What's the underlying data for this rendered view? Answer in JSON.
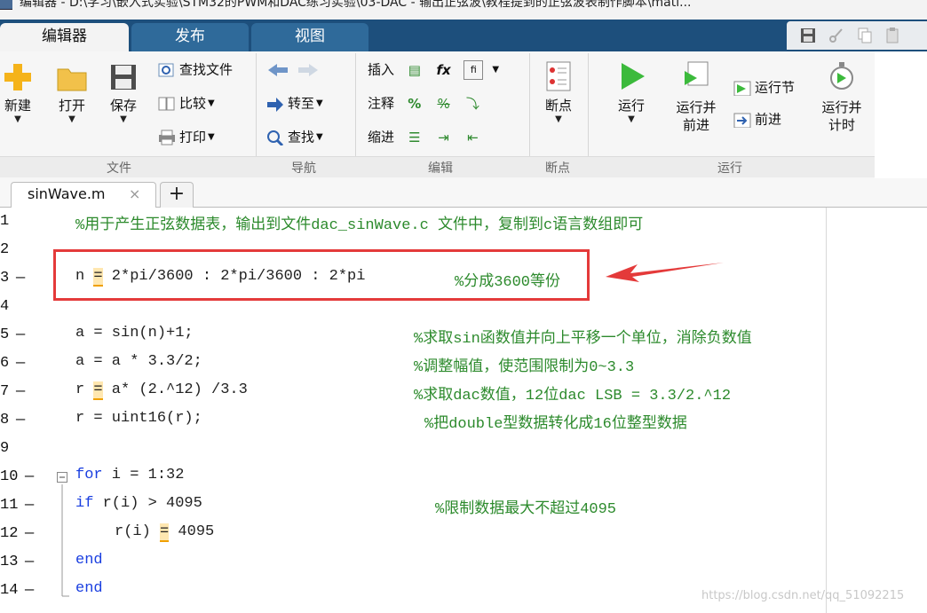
{
  "window": {
    "title": "编辑器 - D:\\学习\\嵌入式实验\\STM32的PWM和DAC练习实验\\03-DAC - 输出正弦波\\教程提到的正弦波表制作脚本\\mati..."
  },
  "tabs": [
    {
      "label": "编辑器",
      "active": true
    },
    {
      "label": "发布",
      "active": false
    },
    {
      "label": "视图",
      "active": false
    }
  ],
  "ribbon": {
    "file": {
      "new": "新建",
      "open": "打开",
      "save": "保存",
      "find_files": "查找文件",
      "compare": "比较",
      "print": "打印",
      "group_label": "文件"
    },
    "navigate": {
      "goto": "转至",
      "find": "查找",
      "group_label": "导航"
    },
    "edit": {
      "insert": "插入",
      "comment": "注释",
      "indent": "缩进",
      "fx": "fx",
      "pct1": "%",
      "pct2": "%",
      "group_label": "编辑"
    },
    "breakpoints": {
      "breakpoint": "断点",
      "group_label": "断点"
    },
    "run": {
      "run": "运行",
      "run_advance_1": "运行并",
      "run_advance_2": "前进",
      "run_section": "运行节",
      "advance": "前进",
      "run_time_1": "运行并",
      "run_time_2": "计时",
      "group_label": "运行"
    }
  },
  "file_tab": {
    "name": "sinWave.m",
    "close": "×",
    "add": "+"
  },
  "code_lines": [
    {
      "num": "1",
      "dash": "",
      "code": "",
      "comment": "%用于产生正弦数据表，输出到文件dac_sinWave.c 文件中，复制到c语言数组即可"
    },
    {
      "num": "2",
      "dash": "",
      "code": "",
      "comment": ""
    },
    {
      "num": "3",
      "dash": "—",
      "code_a": "n ",
      "code_op": "=",
      "code_b": " 2*pi/3600 : 2*pi/3600 : 2*pi",
      "comment": "%分成3600等份"
    },
    {
      "num": "4",
      "dash": "",
      "code": "",
      "comment": ""
    },
    {
      "num": "5",
      "dash": "—",
      "code": "a = sin(n)+1;",
      "comment": "%求取sin函数值并向上平移一个单位，消除负数值"
    },
    {
      "num": "6",
      "dash": "—",
      "code": "a = a * 3.3/2;",
      "comment": "%调整幅值，使范围限制为0~3.3"
    },
    {
      "num": "7",
      "dash": "—",
      "code_a": "r ",
      "code_op": "=",
      "code_b": " a* (2.^12) /3.3",
      "comment": "%求取dac数值，12位dac LSB = 3.3/2.^12"
    },
    {
      "num": "8",
      "dash": "—",
      "code": "r = uint16(r);",
      "comment": "%把double型数据转化成16位整型数据"
    },
    {
      "num": "9",
      "dash": "",
      "code": "",
      "comment": ""
    },
    {
      "num": "10",
      "dash": "—",
      "kw": "for",
      "code": " i = 1:32",
      "comment": ""
    },
    {
      "num": "11",
      "dash": "—",
      "kw": "if",
      "code": " r(i) > 4095",
      "comment": "%限制数据最大不超过4095"
    },
    {
      "num": "12",
      "dash": "—",
      "code_a": "r(i) ",
      "code_op": "=",
      "code_b": " 4095",
      "comment": ""
    },
    {
      "num": "13",
      "dash": "—",
      "kw": "end",
      "code": "",
      "comment": ""
    },
    {
      "num": "14",
      "dash": "—",
      "kw": "end",
      "code": "",
      "comment": ""
    }
  ],
  "watermark": "https://blog.csdn.net/qq_51092215",
  "colors": {
    "tabstrip": "#1d4f7c",
    "comment": "#2c8a2c",
    "keyword": "#1a3fe0",
    "highlight": "#e43a3a"
  }
}
